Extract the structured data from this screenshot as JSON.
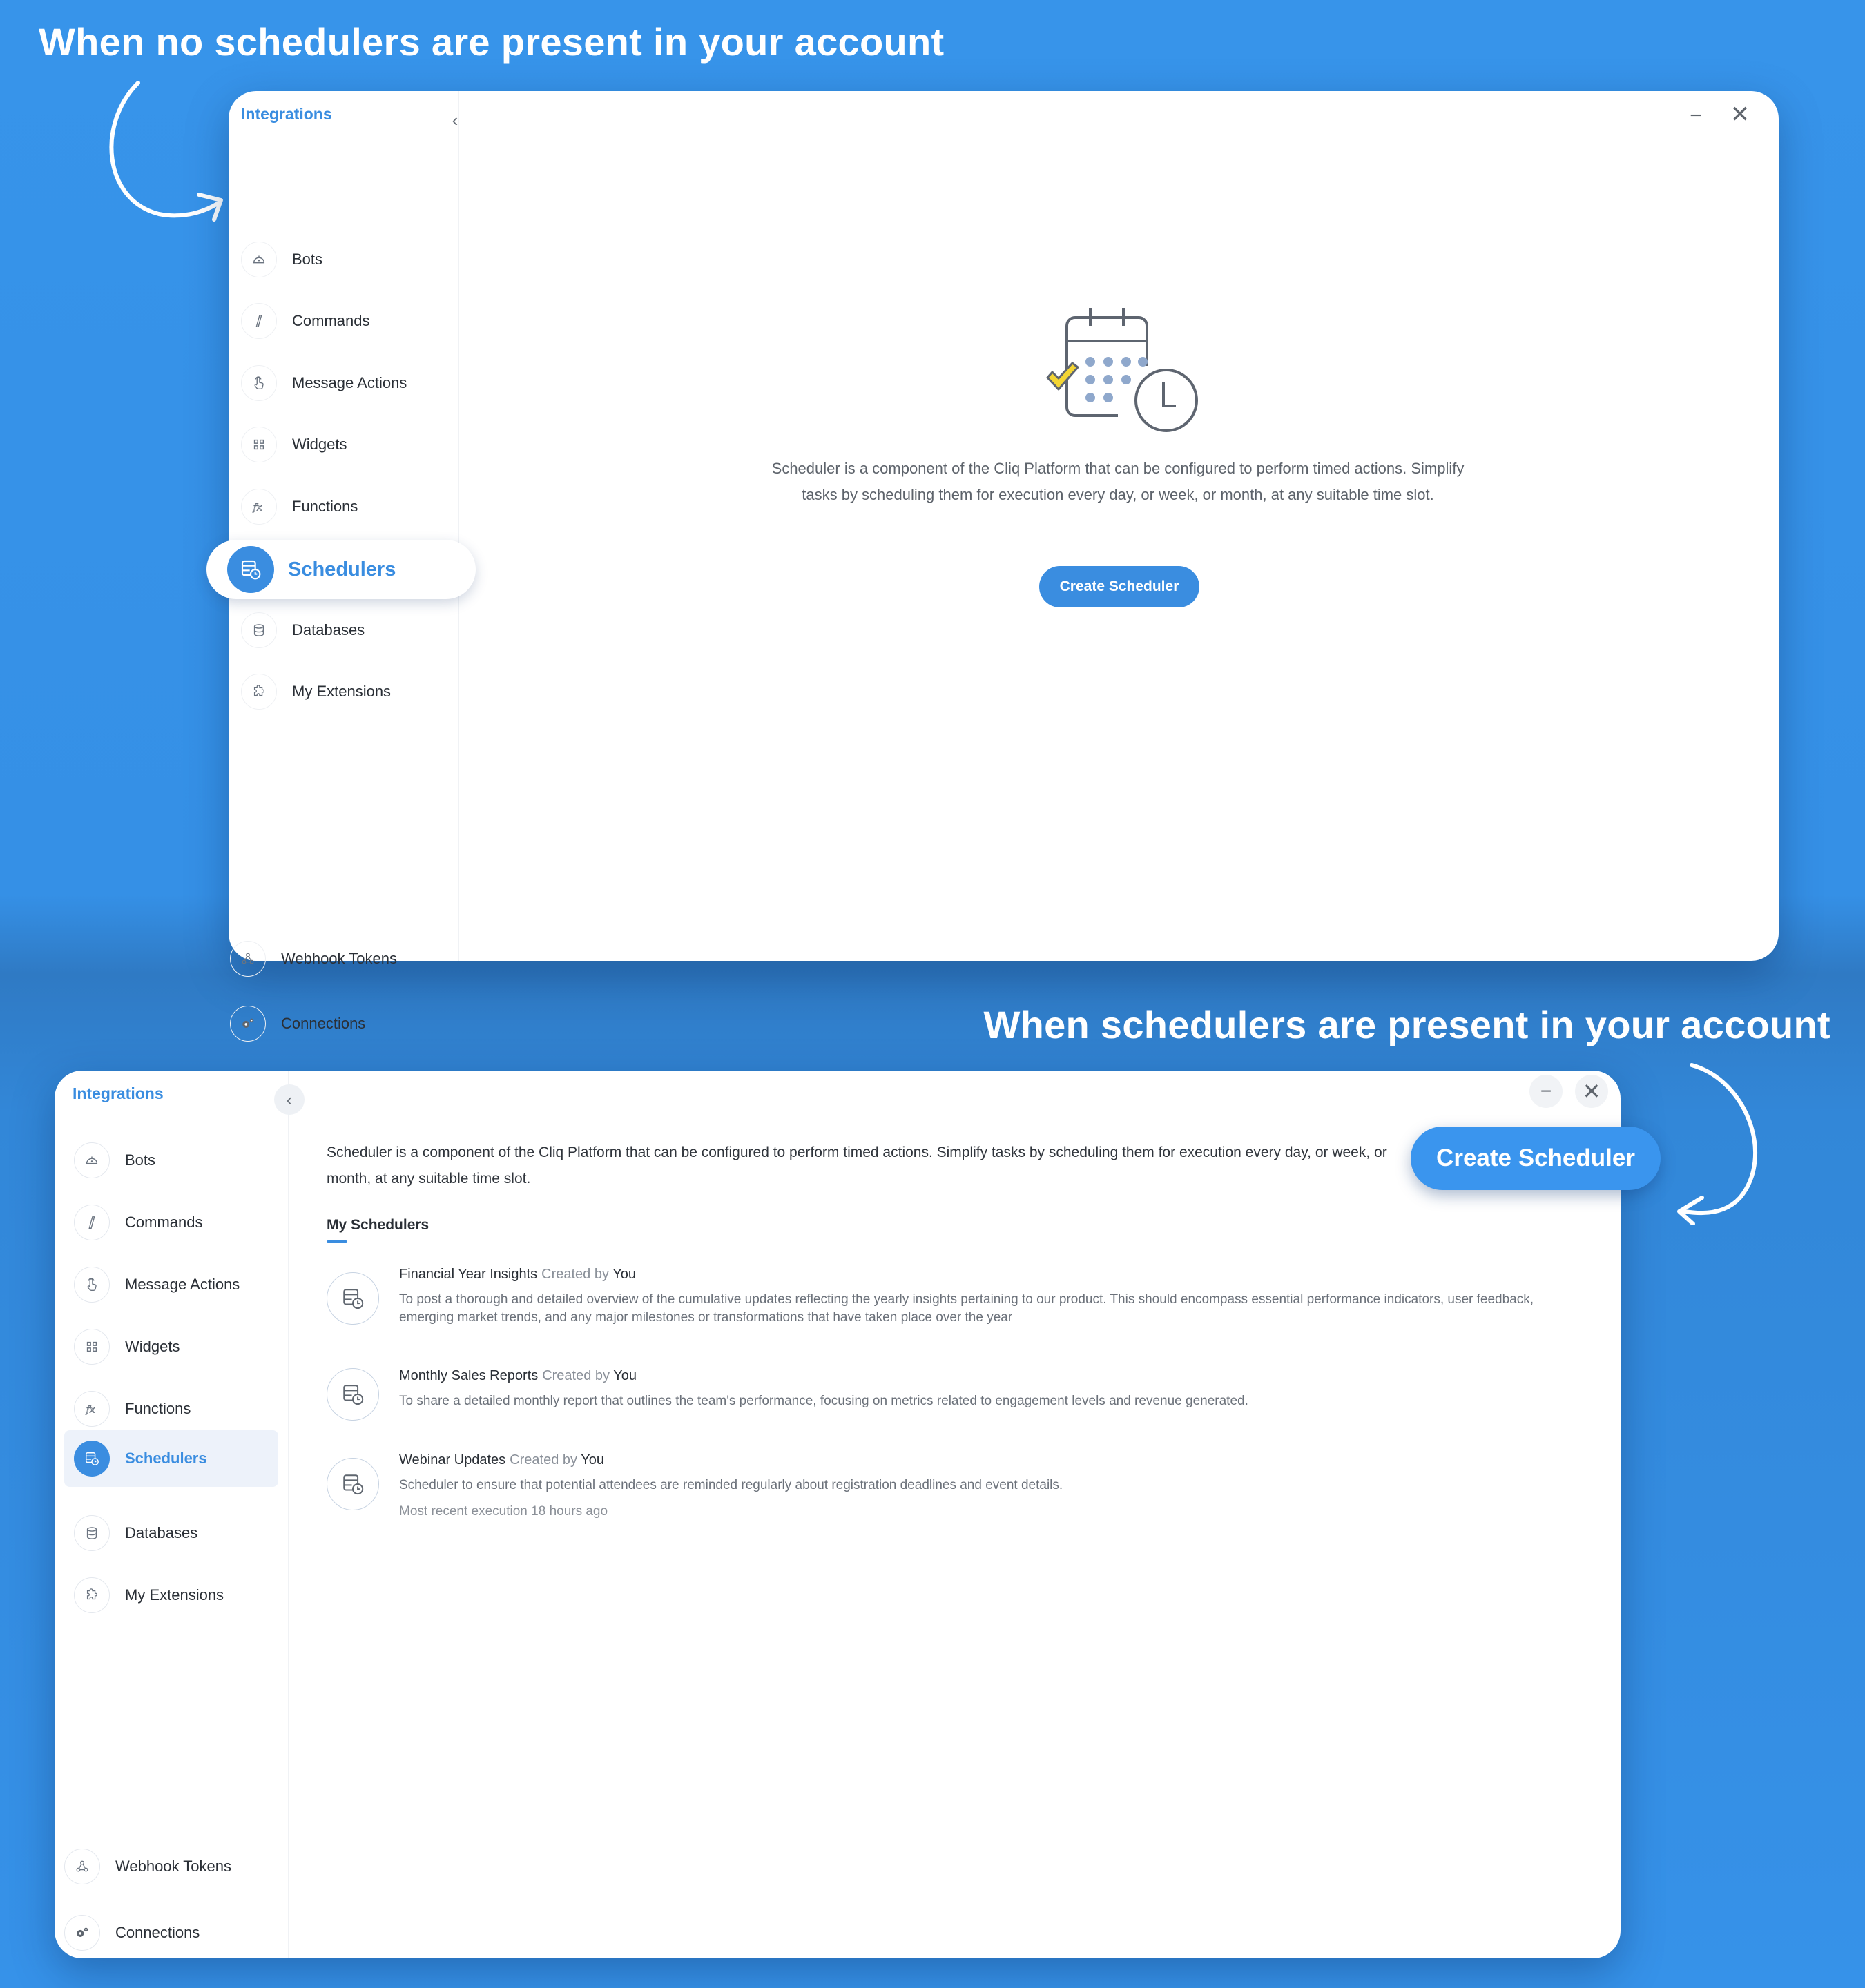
{
  "titles": {
    "empty_state": "When no schedulers are present in your account",
    "populated_state": "When schedulers are present in your account"
  },
  "colors": {
    "accent": "#3a8de0",
    "background": "#3692e9",
    "check_yellow": "#f3d534"
  },
  "sidebar": {
    "title": "Integrations",
    "collapse_icon": "chevron-left-icon",
    "items": [
      {
        "label": "Bots",
        "icon": "bot-icon"
      },
      {
        "label": "Commands",
        "icon": "slash-icon"
      },
      {
        "label": "Message Actions",
        "icon": "tap-icon"
      },
      {
        "label": "Widgets",
        "icon": "grid-icon"
      },
      {
        "label": "Functions",
        "icon": "function-icon"
      },
      {
        "label": "Schedulers",
        "icon": "scheduler-icon",
        "active": true
      },
      {
        "label": "Databases",
        "icon": "database-icon"
      },
      {
        "label": "My Extensions",
        "icon": "puzzle-icon"
      }
    ],
    "footer_items": [
      {
        "label": "Webhook Tokens",
        "icon": "webhook-icon"
      },
      {
        "label": "Connections",
        "icon": "gears-icon"
      }
    ]
  },
  "window_controls": {
    "minimize": "−",
    "close": "✕"
  },
  "empty_state": {
    "description": "Scheduler is a component of the Cliq Platform that can be configured to perform timed actions. Simplify tasks by scheduling them for execution every day, or week, or month, at any suitable time slot.",
    "create_button": "Create Scheduler"
  },
  "populated_state": {
    "description": "Scheduler is a component of the Cliq Platform that can be configured to perform timed actions. Simplify tasks by scheduling them for execution every day, or week, or month, at any suitable time slot.",
    "create_button": "Create Scheduler",
    "section_tab": "My Schedulers",
    "schedulers": [
      {
        "name": "Financial Year Insights",
        "created_by_label": "Created by",
        "created_by": "You",
        "description": "To post a thorough and detailed overview of the cumulative updates reflecting the yearly insights pertaining to our product. This should encompass essential performance indicators, user feedback, emerging market trends, and any major milestones or transformations that have taken place over the year",
        "meta": ""
      },
      {
        "name": "Monthly Sales Reports",
        "created_by_label": "Created by",
        "created_by": "You",
        "description": "To share a detailed monthly report that outlines the team's performance, focusing on metrics related to engagement levels and revenue generated.",
        "meta": ""
      },
      {
        "name": "Webinar Updates",
        "created_by_label": "Created by",
        "created_by": "You",
        "description": "Scheduler to ensure that potential attendees are reminded regularly about registration deadlines and event details.",
        "meta": "Most recent execution 18 hours ago"
      }
    ]
  }
}
